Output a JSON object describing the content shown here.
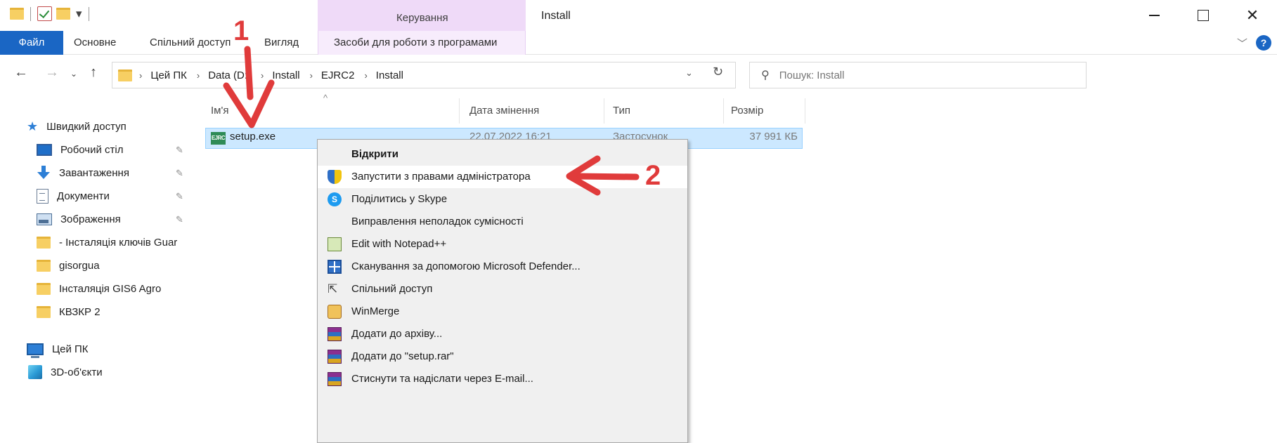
{
  "titlebar": {
    "context_group": "Керування",
    "window_title": "Install"
  },
  "ribbon": {
    "tabs": [
      "Файл",
      "Основне",
      "Спільний доступ",
      "Вигляд"
    ],
    "context_tab": "Засоби для роботи з програмами"
  },
  "address": {
    "crumbs": [
      "Цей ПК",
      "Data (D:)",
      "Install",
      "EJRC2",
      "Install"
    ]
  },
  "search": {
    "placeholder": "Пошук: Install"
  },
  "navpane": {
    "quick_access": "Швидкий доступ",
    "items": [
      "Робочий стіл",
      "Завантаження",
      "Документи",
      "Зображення",
      "- Інсталяція ключів Guar",
      "gisorgua",
      "Інсталяція GIS6 Agro",
      "КВЗКР 2"
    ],
    "this_pc": "Цей ПК",
    "objects3d": "3D-об'єкти"
  },
  "columns": {
    "name": "Ім'я",
    "date": "Дата змінення",
    "type": "Тип",
    "size": "Розмір"
  },
  "file": {
    "icon_text": "EJRC",
    "name": "setup.exe",
    "date": "22.07.2022 16:21",
    "type": "Застосунок",
    "size": "37 991 КБ"
  },
  "context_menu": {
    "items": [
      "Відкрити",
      "Запустити з правами адміністратора",
      "Поділитись у Skype",
      "Виправлення неполадок сумісності",
      "Edit with Notepad++",
      "Сканування за допомогою Microsoft Defender...",
      "Спільний доступ",
      "WinMerge",
      "Додати до архіву...",
      "Додати до \"setup.rar\"",
      "Стиснути та надіслати через E-mail..."
    ]
  },
  "annotations": {
    "step1": "1",
    "step2": "2"
  },
  "colors": {
    "annotation": "#e03b3b",
    "selection": "#cce8ff",
    "file_tab": "#1a66c4",
    "context_tab": "#efdaf8"
  }
}
